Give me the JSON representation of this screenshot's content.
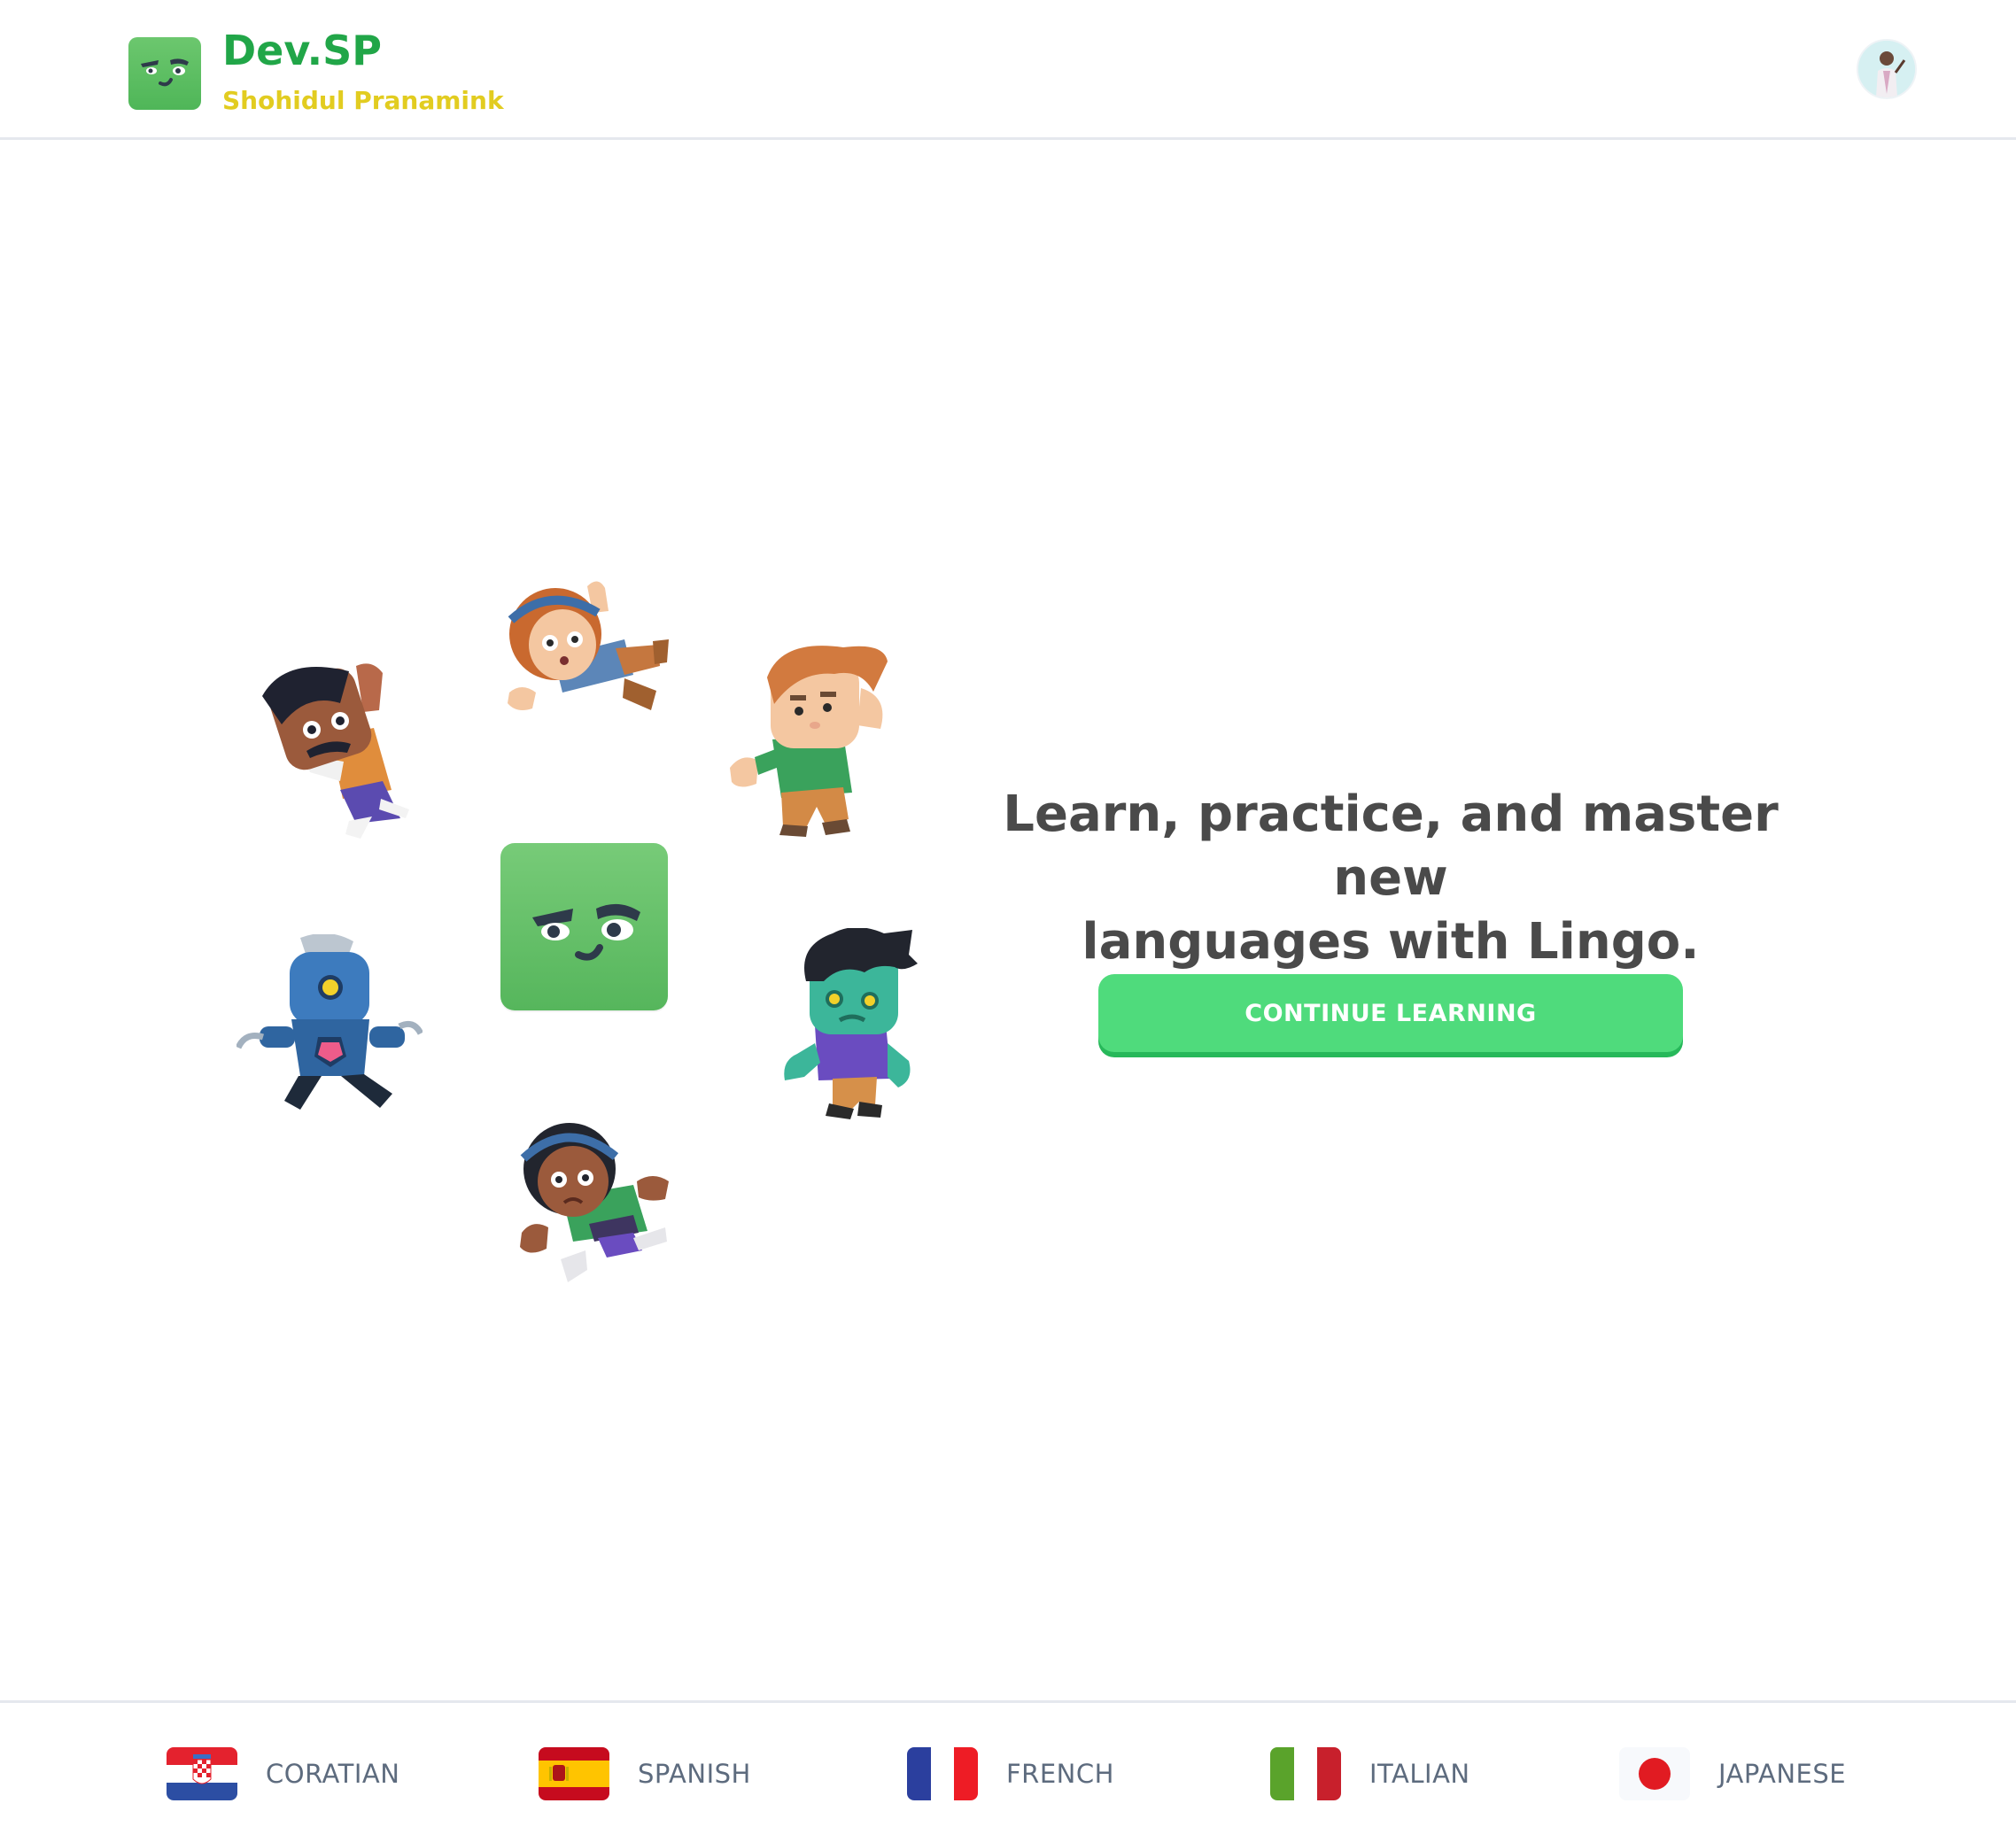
{
  "header": {
    "brand_title": "Dev.SP",
    "brand_subtitle": "Shohidul Pranamink",
    "logo_icon": "mascot-square-icon",
    "avatar_icon": "user-avatar"
  },
  "hero": {
    "headline_line1": "Learn, practice, and master new",
    "headline_line2": "languages with Lingo.",
    "cta_label": "CONTINUE LEARNING",
    "characters": [
      "man-mustache-character",
      "girl-headband-character",
      "boy-green-shirt-character",
      "robot-character",
      "zombie-character",
      "girl-green-shirt-character",
      "mascot-square-icon"
    ]
  },
  "footer": {
    "languages": [
      {
        "label": "CORATIAN",
        "flag": "croatia-flag-icon"
      },
      {
        "label": "SPANISH",
        "flag": "spain-flag-icon"
      },
      {
        "label": "FRENCH",
        "flag": "france-flag-icon"
      },
      {
        "label": "ITALIAN",
        "flag": "italy-flag-icon"
      },
      {
        "label": "JAPANESE",
        "flag": "japan-flag-icon"
      }
    ]
  },
  "colors": {
    "brand_green": "#21a648",
    "brand_yellow": "#e2cc20",
    "cta_green": "#4fdb7c",
    "cta_shadow": "#27b85a",
    "text_dark": "#4a4a4a",
    "footer_text": "#5d6b7e"
  }
}
